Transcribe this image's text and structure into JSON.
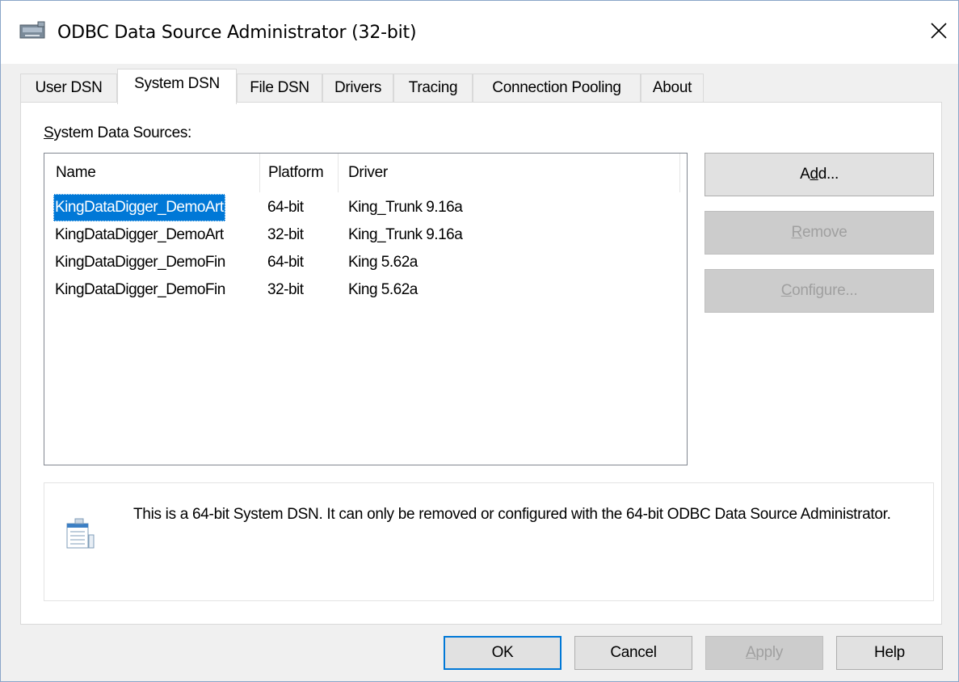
{
  "window": {
    "title": "ODBC Data Source Administrator (32-bit)",
    "close_glyph": "✕"
  },
  "tabs": [
    {
      "label": "User DSN",
      "active": false
    },
    {
      "label": "System DSN",
      "active": true
    },
    {
      "label": "File DSN",
      "active": false
    },
    {
      "label": "Drivers",
      "active": false
    },
    {
      "label": "Tracing",
      "active": false
    },
    {
      "label": "Connection Pooling",
      "active": false
    },
    {
      "label": "About",
      "active": false
    }
  ],
  "panel": {
    "group_label_mnemonic": "S",
    "group_label_rest": "ystem Data Sources:",
    "columns": [
      "Name",
      "Platform",
      "Driver"
    ],
    "rows": [
      {
        "name": "KingDataDigger_DemoArt",
        "platform": "64-bit",
        "driver": "King_Trunk 9.16a",
        "selected": true
      },
      {
        "name": "KingDataDigger_DemoArt",
        "platform": "32-bit",
        "driver": "King_Trunk 9.16a",
        "selected": false
      },
      {
        "name": "KingDataDigger_DemoFin",
        "platform": "64-bit",
        "driver": "King 5.62a",
        "selected": false
      },
      {
        "name": "KingDataDigger_DemoFin",
        "platform": "32-bit",
        "driver": "King 5.62a",
        "selected": false
      }
    ],
    "buttons": {
      "add_pre": "A",
      "add_mn": "d",
      "add_post": "d...",
      "remove_mn": "R",
      "remove_post": "emove",
      "configure_mn": "C",
      "configure_post": "onfigure..."
    },
    "info_text": "This is a 64-bit System DSN. It can only be removed or configured with the 64-bit ODBC Data Source Administrator."
  },
  "footer": {
    "ok": "OK",
    "cancel": "Cancel",
    "apply_mn": "A",
    "apply_post": "pply",
    "help": "Help"
  },
  "colors": {
    "selection": "#0078d7",
    "default_button_border": "#0078d7"
  }
}
